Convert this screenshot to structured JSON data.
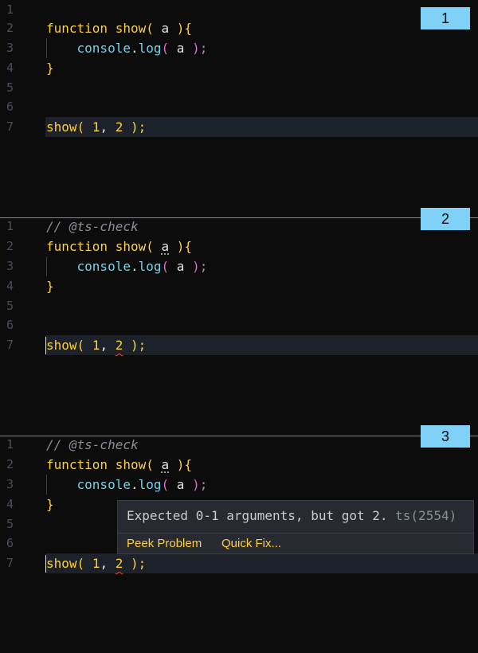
{
  "panels": [
    {
      "badge": "1",
      "lines": [
        {
          "n": "1"
        },
        {
          "n": "2"
        },
        {
          "n": "3"
        },
        {
          "n": "4"
        },
        {
          "n": "5"
        },
        {
          "n": "6"
        },
        {
          "n": "7"
        }
      ]
    },
    {
      "badge": "2",
      "lines": [
        {
          "n": "1"
        },
        {
          "n": "2"
        },
        {
          "n": "3"
        },
        {
          "n": "4"
        },
        {
          "n": "5"
        },
        {
          "n": "6"
        },
        {
          "n": "7"
        }
      ]
    },
    {
      "badge": "3",
      "lines": [
        {
          "n": "1"
        },
        {
          "n": "2"
        },
        {
          "n": "3"
        },
        {
          "n": "4"
        },
        {
          "n": "5"
        },
        {
          "n": "6"
        },
        {
          "n": "7"
        }
      ]
    }
  ],
  "code": {
    "comment": "// @ts-check",
    "kw_function": "function",
    "fn_name": "show",
    "open_paren": "(",
    "param": "a",
    "close_paren_brace": "){",
    "console": "console",
    "dot": ".",
    "log": "log",
    "log_open": "(",
    "log_arg": "a",
    "log_close": ");",
    "close_brace": "}",
    "call_name": "show",
    "call_open": "(",
    "arg1": "1",
    "comma": ",",
    "arg2": "2",
    "call_close": ");"
  },
  "hover": {
    "message": "Expected 0-1 arguments, but got 2.",
    "code": "ts(2554)",
    "actions": {
      "peek": "Peek Problem",
      "quick_fix": "Quick Fix..."
    }
  },
  "colors": {
    "background": "#0c0c0d",
    "keyword": "#ffd03c",
    "object": "#74d4ea",
    "bracket_nested": "#da70d6",
    "badge": "#7fd1f7",
    "error": "#e24c3c"
  }
}
